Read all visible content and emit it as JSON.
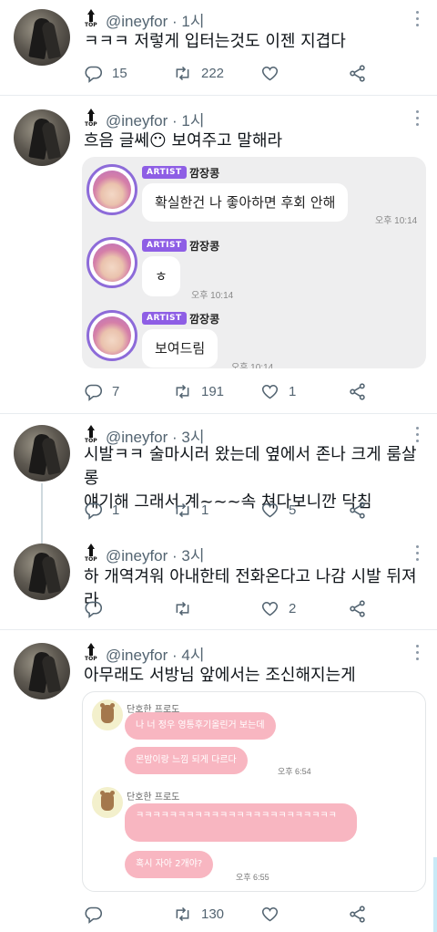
{
  "tweets": [
    {
      "handle": "@ineyfor · 1시",
      "text": "ㅋㅋㅋ 저렇게 입터는것도 이젠 지겹다",
      "replies": "15",
      "retweets": "222",
      "likes": ""
    },
    {
      "handle": "@ineyfor · 1시",
      "text": "흐음 글쎄😶 보여주고 말해라",
      "replies": "7",
      "retweets": "191",
      "likes": "1",
      "chat": [
        {
          "badge": "ARTIST",
          "name": "깜장콩",
          "message": "확실한건 나 좋아하면 후회 안해",
          "time": "오후 10:14"
        },
        {
          "badge": "ARTIST",
          "name": "깜장콩",
          "message": "ㅎ",
          "time": "오후 10:14"
        },
        {
          "badge": "ARTIST",
          "name": "깜장콩",
          "message": "보여드림",
          "time": "오후 10:14"
        }
      ]
    },
    {
      "handle": "@ineyfor · 3시",
      "text": "시발ㅋㅋ 술마시러 왔는데 옆에서 존나 크게 룸살롱\n얘기해 그래서 계~~~속 쳐다보니깐 닥침",
      "replies": "1",
      "retweets": "1",
      "likes": "5"
    },
    {
      "handle": "@ineyfor · 3시",
      "text": "하 개역겨워 아내한테 전화온다고 나감 시발 뒤져라",
      "replies": "",
      "retweets": "",
      "likes": "2"
    },
    {
      "handle": "@ineyfor · 4시",
      "text": "아무래도 서방님 앞에서는 조신해지는게",
      "replies": "",
      "retweets": "130",
      "likes": "",
      "chat": [
        {
          "name": "단호한 프로도",
          "messages": [
            "나 너 정우 영통후기올린거 보는데",
            "몬밤이랑 느낌 되게 다르다"
          ],
          "time": "오후 6:54"
        },
        {
          "name": "단호한 프로도",
          "messages": [
            "ㅋㅋㅋㅋㅋㅋㅋㅋㅋㅋㅋㅋㅋㅋㅋㅋㅋㅋㅋㅋㅋㅋㅋㅋ",
            "혹시 자아 2개야?"
          ],
          "time": "오후 6:55"
        }
      ]
    }
  ],
  "top_icon_label": "TOP",
  "icons": {
    "reply": "reply-icon",
    "retweet": "retweet-icon",
    "like": "heart-icon",
    "share": "share-icon",
    "more": "more-icon"
  }
}
